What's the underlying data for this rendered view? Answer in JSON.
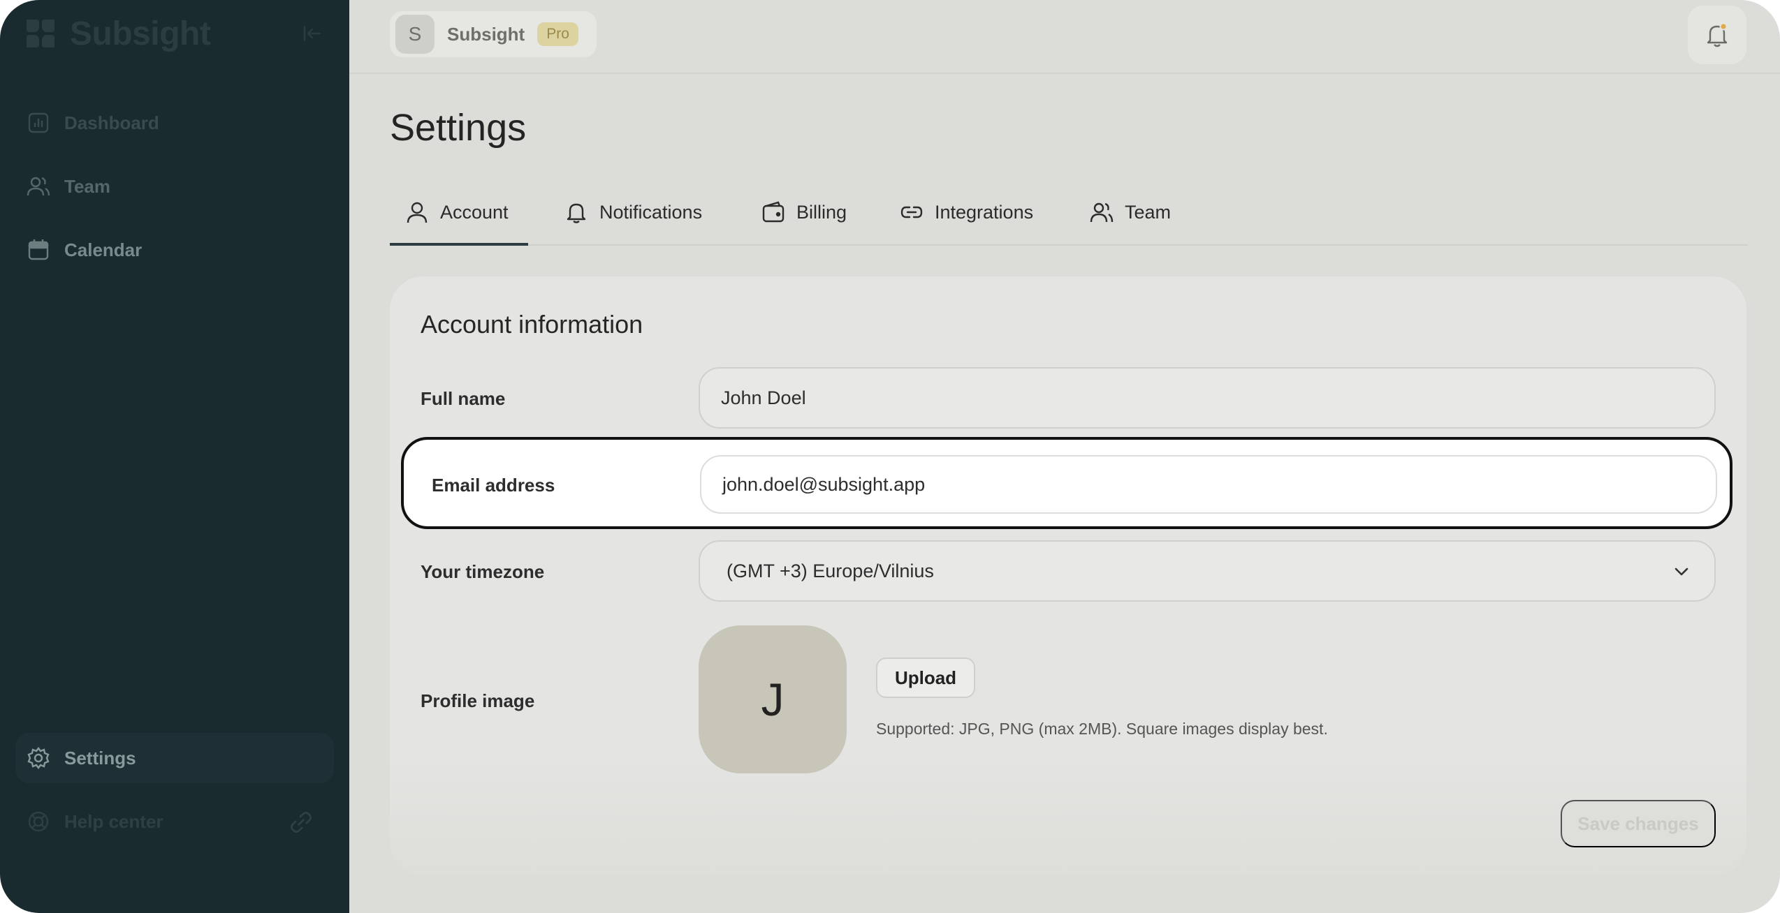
{
  "brand": {
    "name": "Subsight"
  },
  "sidebar": {
    "items": [
      {
        "label": "Dashboard",
        "icon": "chart-icon"
      },
      {
        "label": "Team",
        "icon": "users-icon"
      },
      {
        "label": "Calendar",
        "icon": "calendar-icon"
      }
    ],
    "footer_items": [
      {
        "label": "Settings",
        "icon": "gear-icon",
        "active": true
      },
      {
        "label": "Help center",
        "icon": "lifebuoy-icon",
        "external": true
      }
    ]
  },
  "topbar": {
    "workspace_initial": "S",
    "workspace_name": "Subsight",
    "plan_badge": "Pro",
    "notifications_icon": "bell-icon",
    "has_unread": true
  },
  "page": {
    "title": "Settings",
    "tabs": [
      {
        "label": "Account",
        "icon": "user-icon",
        "active": true
      },
      {
        "label": "Notifications",
        "icon": "bell-icon"
      },
      {
        "label": "Billing",
        "icon": "wallet-icon"
      },
      {
        "label": "Integrations",
        "icon": "link-icon"
      },
      {
        "label": "Team",
        "icon": "users-icon"
      }
    ]
  },
  "account": {
    "section_title": "Account information",
    "full_name": {
      "label": "Full name",
      "value": "John Doel"
    },
    "email": {
      "label": "Email address",
      "value": "john.doel@subsight.app"
    },
    "timezone": {
      "label": "Your timezone",
      "value": "(GMT +3) Europe/Vilnius"
    },
    "profile_image": {
      "label": "Profile image",
      "initial": "J",
      "upload_label": "Upload",
      "hint": "Supported: JPG, PNG (max 2MB). Square images display best."
    },
    "save_label": "Save changes"
  },
  "colors": {
    "sidebar_bg": "#1a2b30",
    "page_bg": "#dcdcd8",
    "card_bg": "#e4e4e2",
    "badge_bg": "#ddd3a0",
    "notification_dot": "#e0a848"
  }
}
